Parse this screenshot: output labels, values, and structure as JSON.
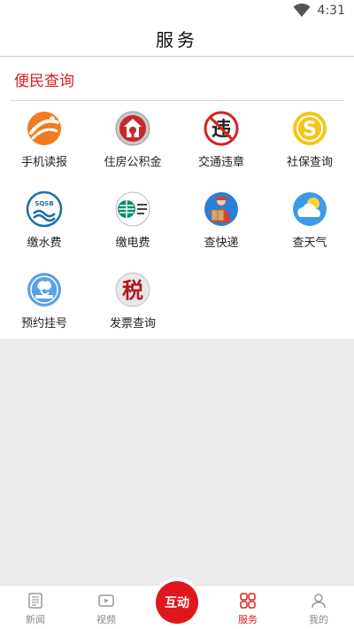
{
  "status_bar": {
    "time": "4:31"
  },
  "header": {
    "title": "服务"
  },
  "section": {
    "title": "便民查询"
  },
  "services": [
    {
      "label": "手机读报",
      "icon": "newspaper-reader-icon"
    },
    {
      "label": "住房公积金",
      "icon": "housing-fund-icon"
    },
    {
      "label": "交通违章",
      "icon": "traffic-violation-icon"
    },
    {
      "label": "社保查询",
      "icon": "social-security-icon"
    },
    {
      "label": "缴水费",
      "icon": "water-bill-icon"
    },
    {
      "label": "缴电费",
      "icon": "electricity-bill-icon"
    },
    {
      "label": "查快递",
      "icon": "express-delivery-icon"
    },
    {
      "label": "查天气",
      "icon": "weather-icon"
    },
    {
      "label": "预约挂号",
      "icon": "hospital-appointment-icon"
    },
    {
      "label": "发票查询",
      "icon": "tax-invoice-icon"
    }
  ],
  "icon_texts": {
    "traffic_char": "违",
    "social_char": "S",
    "water_char": "SQSB",
    "tax_char": "税"
  },
  "tab_bar": {
    "tabs": [
      {
        "label": "新闻",
        "icon": "news-icon",
        "active": false
      },
      {
        "label": "视频",
        "icon": "video-icon",
        "active": false
      },
      {
        "label": "服务",
        "icon": "services-grid-icon",
        "active": true
      },
      {
        "label": "我的",
        "icon": "profile-icon",
        "active": false
      }
    ],
    "center_button": {
      "label": "互动"
    }
  },
  "colors": {
    "accent": "#d9201e",
    "center_button": "#e0171c",
    "background": "#ececec"
  }
}
